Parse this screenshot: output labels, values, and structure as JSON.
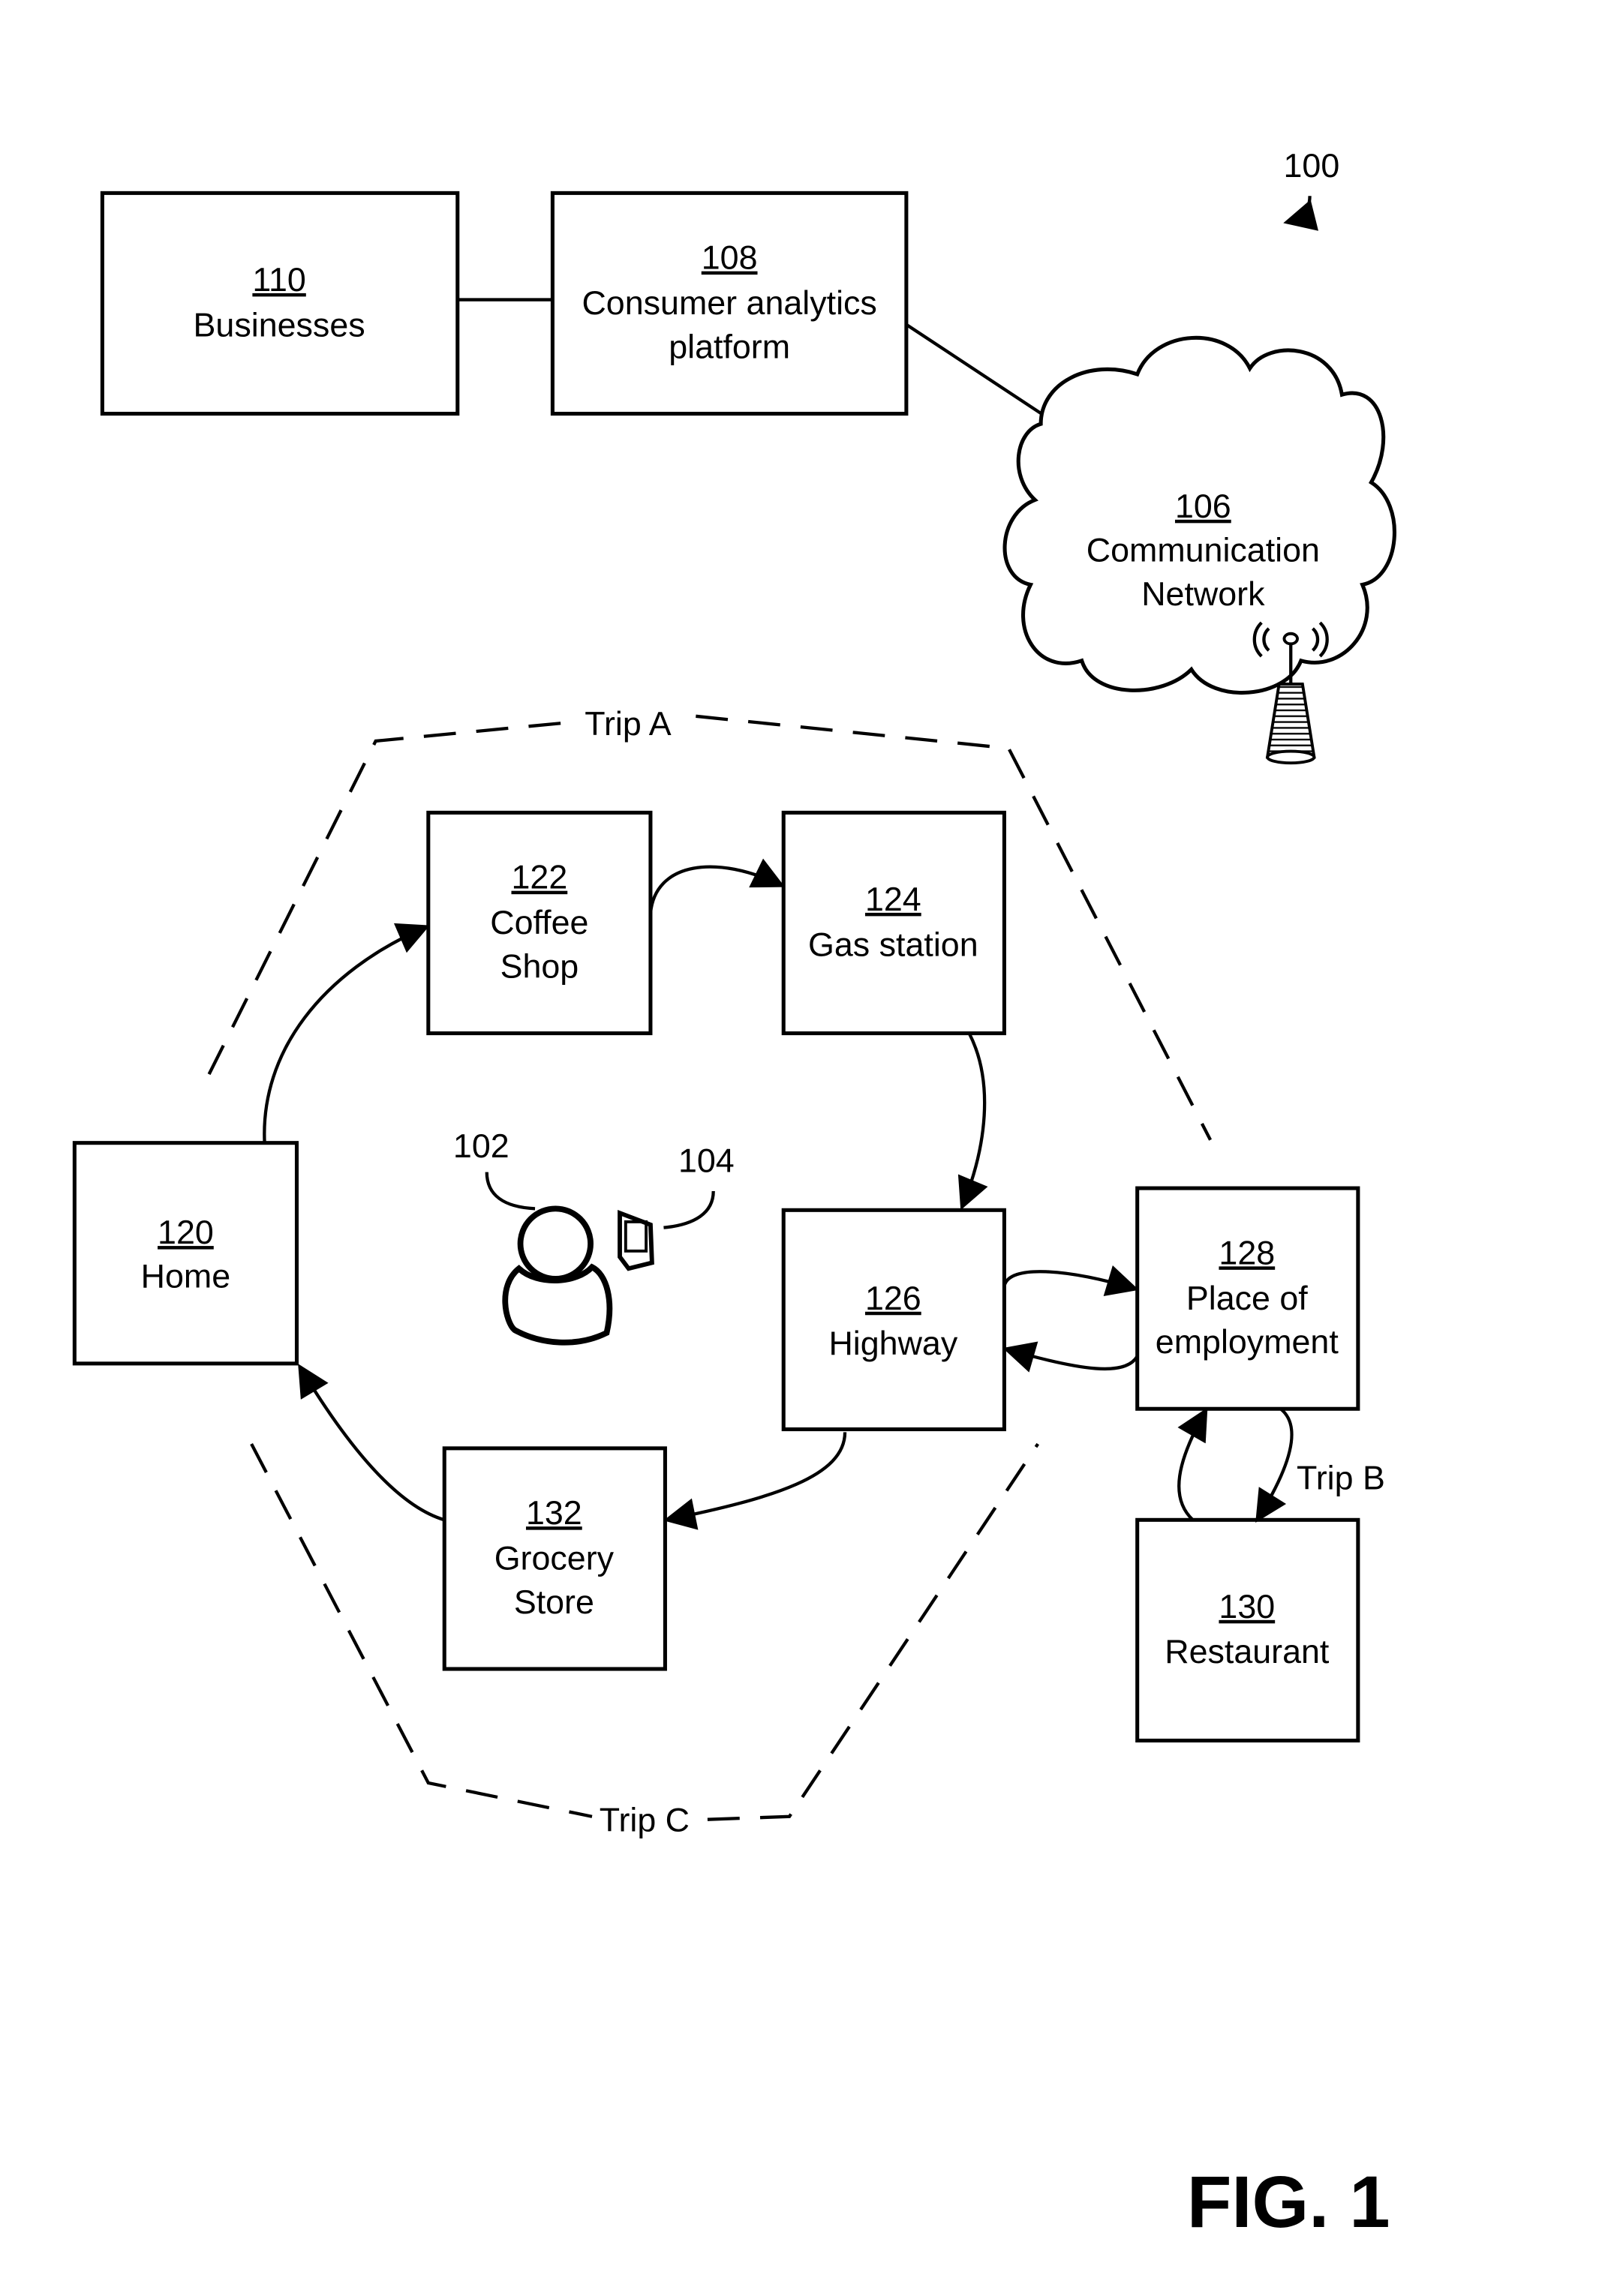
{
  "figure": {
    "ref_number": "100",
    "caption": "FIG. 1"
  },
  "nodes": {
    "businesses": {
      "number": "110",
      "label": [
        "Businesses"
      ]
    },
    "platform": {
      "number": "108",
      "label": [
        "Consumer analytics",
        "platform"
      ]
    },
    "network": {
      "number": "106",
      "label": [
        "Communication",
        "Network"
      ]
    },
    "home": {
      "number": "120",
      "label": [
        "Home"
      ]
    },
    "coffee": {
      "number": "122",
      "label": [
        "Coffee",
        "Shop"
      ]
    },
    "gas": {
      "number": "124",
      "label": [
        "Gas station"
      ]
    },
    "highway": {
      "number": "126",
      "label": [
        "Highway"
      ]
    },
    "employment": {
      "number": "128",
      "label": [
        "Place of",
        "employment"
      ]
    },
    "restaurant": {
      "number": "130",
      "label": [
        "Restaurant"
      ]
    },
    "grocery": {
      "number": "132",
      "label": [
        "Grocery",
        "Store"
      ]
    }
  },
  "actors": {
    "user": {
      "number": "102",
      "icon": "person-icon"
    },
    "device": {
      "number": "104",
      "icon": "mobile-device-icon"
    }
  },
  "trips": {
    "a": "Trip A",
    "b": "Trip B",
    "c": "Trip C"
  },
  "icons": {
    "tower": "cell-tower-icon"
  },
  "colors": {
    "ink": "#000000",
    "paper": "#ffffff"
  }
}
